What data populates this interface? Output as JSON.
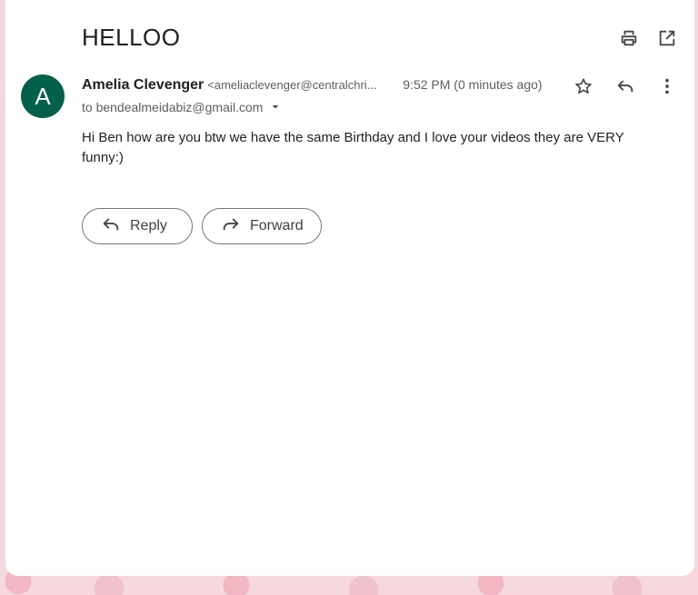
{
  "email": {
    "subject": "HELLOO",
    "avatar_letter": "A",
    "avatar_color": "#00604a",
    "sender_name": "Amelia Clevenger",
    "sender_email": "<ameliaclevenger@centralchri...",
    "timestamp": "9:52 PM (0 minutes ago)",
    "to_line": "to bendealmeidabiz@gmail.com",
    "body": "Hi Ben how are you btw we have the same Birthday and I love your videos they are VERY funny:)"
  },
  "actions": {
    "reply_label": "Reply",
    "forward_label": "Forward"
  },
  "icons": {
    "top": [
      "print-icon",
      "open-in-new-window-icon"
    ],
    "message": [
      "star-icon",
      "reply-icon",
      "more-vert-icon"
    ]
  }
}
